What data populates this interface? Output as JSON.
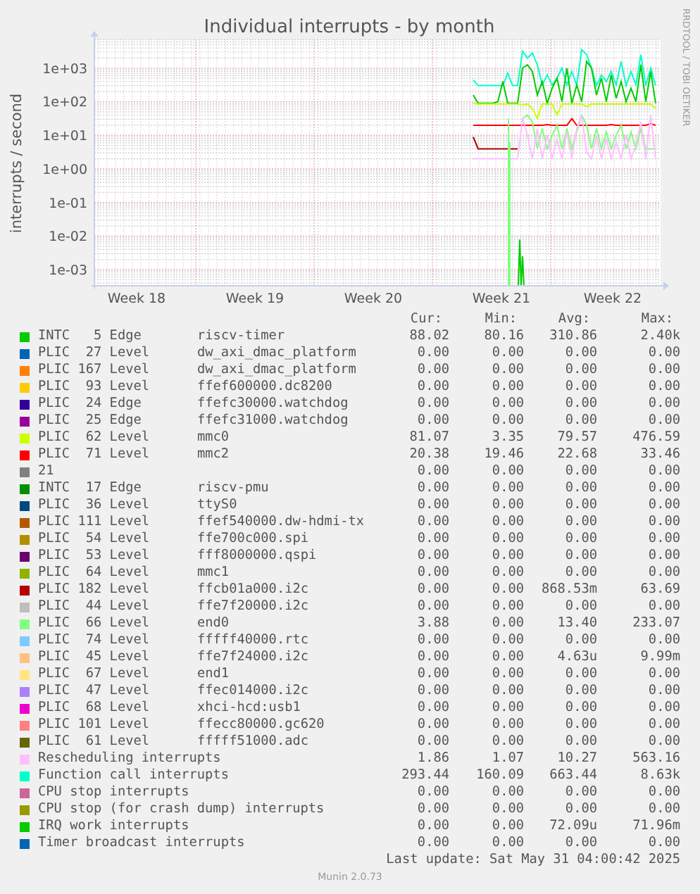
{
  "graph": {
    "title": "Individual interrupts - by month",
    "credit": "RRDTOOL / TOBI OETIKER",
    "ylabel": "interrupts / second",
    "y_tick_labels": [
      "1e+03",
      "1e+02",
      "1e+01",
      "1e+00",
      "1e-01",
      "1e-02",
      "1e-03"
    ],
    "x_tick_labels": [
      "Week 18",
      "Week 19",
      "Week 20",
      "Week 21",
      "Week 22"
    ]
  },
  "legend": {
    "columns": [
      "Cur:",
      "Min:",
      "Avg:",
      "Max:"
    ],
    "rows": [
      {
        "source": "INTC   5 Edge",
        "device": "riscv-timer",
        "color": "#00cc00",
        "cur": "88.02",
        "min": "80.16",
        "avg": "310.86",
        "max": "2.40k"
      },
      {
        "source": "PLIC  27 Level",
        "device": "dw_axi_dmac_platform",
        "color": "#0066b3",
        "cur": "0.00",
        "min": "0.00",
        "avg": "0.00",
        "max": "0.00"
      },
      {
        "source": "PLIC 167 Level",
        "device": "dw_axi_dmac_platform",
        "color": "#ff8000",
        "cur": "0.00",
        "min": "0.00",
        "avg": "0.00",
        "max": "0.00"
      },
      {
        "source": "PLIC  93 Level",
        "device": "ffef600000.dc8200",
        "color": "#ffcc00",
        "cur": "0.00",
        "min": "0.00",
        "avg": "0.00",
        "max": "0.00"
      },
      {
        "source": "PLIC  24 Edge",
        "device": "ffefc30000.watchdog",
        "color": "#330099",
        "cur": "0.00",
        "min": "0.00",
        "avg": "0.00",
        "max": "0.00"
      },
      {
        "source": "PLIC  25 Edge",
        "device": "ffefc31000.watchdog",
        "color": "#990099",
        "cur": "0.00",
        "min": "0.00",
        "avg": "0.00",
        "max": "0.00"
      },
      {
        "source": "PLIC  62 Level",
        "device": "mmc0",
        "color": "#ccff00",
        "cur": "81.07",
        "min": "3.35",
        "avg": "79.57",
        "max": "476.59"
      },
      {
        "source": "PLIC  71 Level",
        "device": "mmc2",
        "color": "#ff0000",
        "cur": "20.38",
        "min": "19.46",
        "avg": "22.68",
        "max": "33.46"
      },
      {
        "source": "21",
        "color": "#808080",
        "cur": "0.00",
        "min": "0.00",
        "avg": "0.00",
        "max": "0.00"
      },
      {
        "source": "INTC  17 Edge",
        "device": "riscv-pmu",
        "color": "#008f00",
        "cur": "0.00",
        "min": "0.00",
        "avg": "0.00",
        "max": "0.00"
      },
      {
        "source": "PLIC  36 Level",
        "device": "ttyS0",
        "color": "#00487d",
        "cur": "0.00",
        "min": "0.00",
        "avg": "0.00",
        "max": "0.00"
      },
      {
        "source": "PLIC 111 Level",
        "device": "ffef540000.dw-hdmi-tx",
        "color": "#b35a00",
        "cur": "0.00",
        "min": "0.00",
        "avg": "0.00",
        "max": "0.00"
      },
      {
        "source": "PLIC  54 Level",
        "device": "ffe700c000.spi",
        "color": "#b38f00",
        "cur": "0.00",
        "min": "0.00",
        "avg": "0.00",
        "max": "0.00"
      },
      {
        "source": "PLIC  53 Level",
        "device": "fff8000000.qspi",
        "color": "#6b006b",
        "cur": "0.00",
        "min": "0.00",
        "avg": "0.00",
        "max": "0.00"
      },
      {
        "source": "PLIC  64 Level",
        "device": "mmc1",
        "color": "#8fb300",
        "cur": "0.00",
        "min": "0.00",
        "avg": "0.00",
        "max": "0.00"
      },
      {
        "source": "PLIC 182 Level",
        "device": "ffcb01a000.i2c",
        "color": "#b30000",
        "cur": "0.00",
        "min": "0.00",
        "avg": "868.53m",
        "max": "63.69"
      },
      {
        "source": "PLIC  44 Level",
        "device": "ffe7f20000.i2c",
        "color": "#bebebe",
        "cur": "0.00",
        "min": "0.00",
        "avg": "0.00",
        "max": "0.00"
      },
      {
        "source": "PLIC  66 Level",
        "device": "end0",
        "color": "#80ff80",
        "cur": "3.88",
        "min": "0.00",
        "avg": "13.40",
        "max": "233.07"
      },
      {
        "source": "PLIC  74 Level",
        "device": "fffff40000.rtc",
        "color": "#80c9ff",
        "cur": "0.00",
        "min": "0.00",
        "avg": "0.00",
        "max": "0.00"
      },
      {
        "source": "PLIC  45 Level",
        "device": "ffe7f24000.i2c",
        "color": "#ffc080",
        "cur": "0.00",
        "min": "0.00",
        "avg": "4.63u",
        "max": "9.99m"
      },
      {
        "source": "PLIC  67 Level",
        "device": "end1",
        "color": "#ffe680",
        "cur": "0.00",
        "min": "0.00",
        "avg": "0.00",
        "max": "0.00"
      },
      {
        "source": "PLIC  47 Level",
        "device": "ffec014000.i2c",
        "color": "#aa80ff",
        "cur": "0.00",
        "min": "0.00",
        "avg": "0.00",
        "max": "0.00"
      },
      {
        "source": "PLIC  68 Level",
        "device": "xhci-hcd:usb1",
        "color": "#ee00cc",
        "cur": "0.00",
        "min": "0.00",
        "avg": "0.00",
        "max": "0.00"
      },
      {
        "source": "PLIC 101 Level",
        "device": "ffecc80000.gc620",
        "color": "#ff8080",
        "cur": "0.00",
        "min": "0.00",
        "avg": "0.00",
        "max": "0.00"
      },
      {
        "source": "PLIC  61 Level",
        "device": "fffff51000.adc",
        "color": "#666600",
        "cur": "0.00",
        "min": "0.00",
        "avg": "0.00",
        "max": "0.00"
      },
      {
        "source": "Rescheduling interrupts",
        "color": "#ffbfff",
        "cur": "1.86",
        "min": "1.07",
        "avg": "10.27",
        "max": "563.16"
      },
      {
        "source": "Function call interrupts",
        "color": "#00ffcc",
        "cur": "293.44",
        "min": "160.09",
        "avg": "663.44",
        "max": "8.63k"
      },
      {
        "source": "CPU stop interrupts",
        "color": "#cc6699",
        "cur": "0.00",
        "min": "0.00",
        "avg": "0.00",
        "max": "0.00"
      },
      {
        "source": "CPU stop (for crash dump) interrupts",
        "color": "#999900",
        "cur": "0.00",
        "min": "0.00",
        "avg": "0.00",
        "max": "0.00"
      },
      {
        "source": "IRQ work interrupts",
        "color": "#00cc00",
        "cur": "0.00",
        "min": "0.00",
        "avg": "72.09u",
        "max": "71.96m"
      },
      {
        "source": "Timer broadcast interrupts",
        "color": "#0066b3",
        "cur": "0.00",
        "min": "0.00",
        "avg": "0.00",
        "max": "0.00"
      }
    ]
  },
  "last_update": "Last update: Sat May 31 04:00:42 2025",
  "footer": "Munin 2.0.73"
}
